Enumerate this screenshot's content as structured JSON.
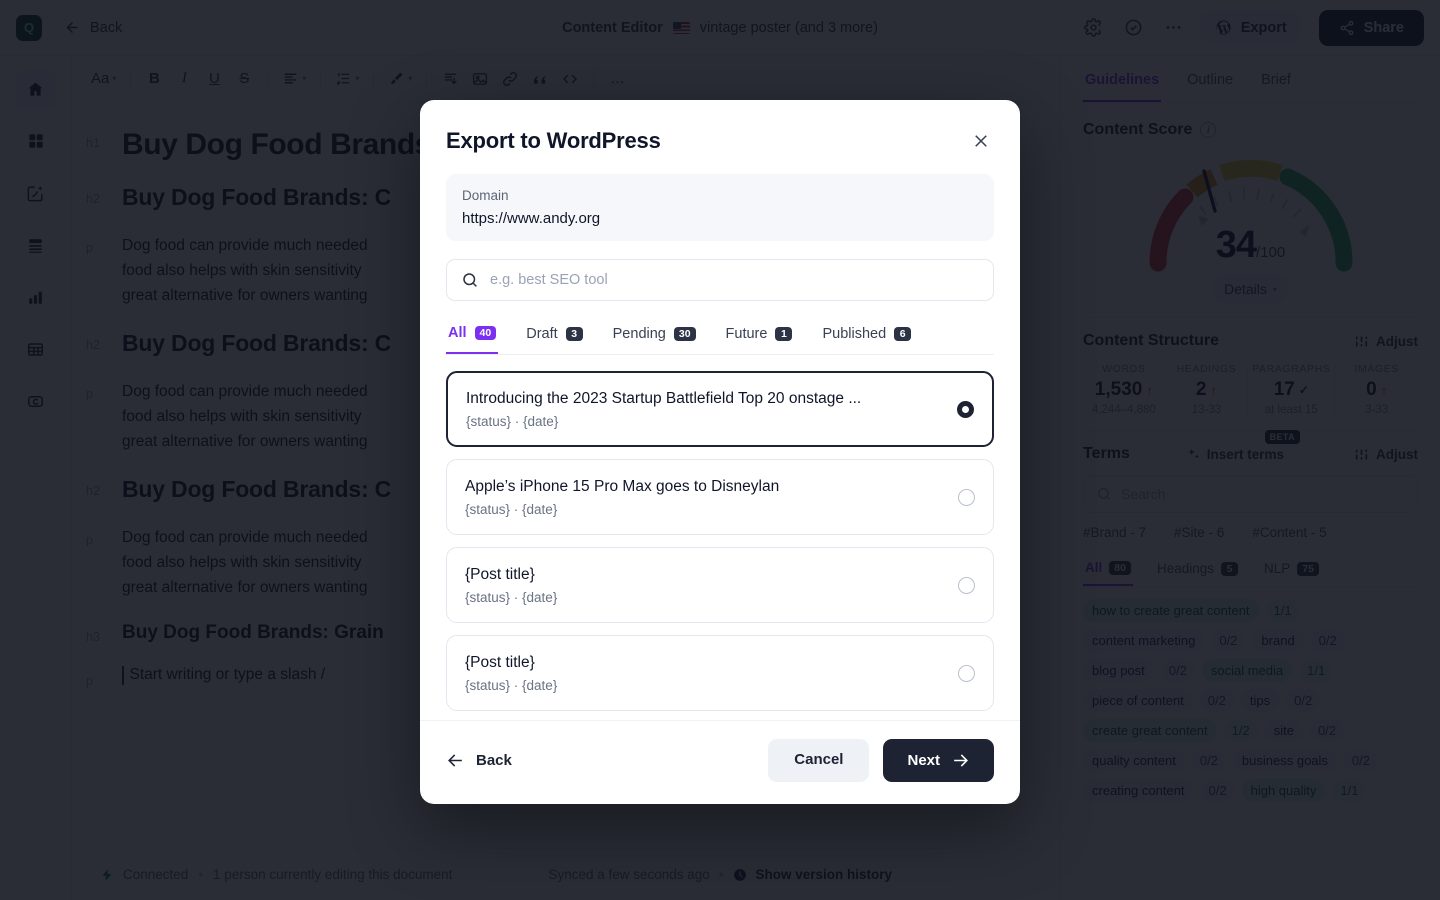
{
  "app": {
    "logo_text": "Q",
    "back_label": "Back",
    "header_title": "Content Editor",
    "document_name": "vintage poster (and 3 more)",
    "export_label": "Export",
    "share_label": "Share"
  },
  "rail": [
    {
      "name": "home-icon"
    },
    {
      "name": "grid-icon"
    },
    {
      "name": "magic-edit-icon"
    },
    {
      "name": "list-icon"
    },
    {
      "name": "bar-chart-icon"
    },
    {
      "name": "table-icon"
    },
    {
      "name": "badge-icon"
    }
  ],
  "toolbar": {
    "font_label": "Aa",
    "bold": "B",
    "italic": "I",
    "underline": "U",
    "strike": "S",
    "more": "…"
  },
  "document": {
    "blocks": [
      {
        "tag": "h1",
        "text": "Buy Dog Food Brands",
        "style": "h1t"
      },
      {
        "tag": "h2",
        "text": "Buy Dog Food Brands: C",
        "style": "h2t"
      },
      {
        "tag": "p",
        "text": "Dog food can provide much needed\nfood also helps with skin sensitivity\ngreat alternative for owners wanting",
        "style": "pt"
      },
      {
        "tag": "h2",
        "text": "Buy Dog Food Brands: C",
        "style": "h2t"
      },
      {
        "tag": "p",
        "text": "Dog food can provide much needed\nfood also helps with skin sensitivity\ngreat alternative for owners wanting",
        "style": "pt"
      },
      {
        "tag": "h2",
        "text": "Buy Dog Food Brands: C",
        "style": "h2t"
      },
      {
        "tag": "p",
        "text": "Dog food can provide much needed\nfood also helps with skin sensitivity\ngreat alternative for owners wanting",
        "style": "pt"
      },
      {
        "tag": "h3",
        "text": "Buy Dog Food Brands: Grain",
        "style": "h3t"
      }
    ],
    "editor_placeholder": "Start writing or type a slash /"
  },
  "status": {
    "connection": "Connected",
    "sep": "•",
    "editors": "1 person currently editing this document",
    "synced": "Synced a few seconds ago",
    "version_history": "Show version history"
  },
  "right_panel": {
    "tabs": [
      {
        "label": "Guidelines",
        "active": true
      },
      {
        "label": "Outline",
        "active": false
      },
      {
        "label": "Brief",
        "active": false
      }
    ],
    "content_score": {
      "title": "Content Score",
      "value": "34",
      "max": "/100",
      "details_label": "Details"
    },
    "content_structure": {
      "title": "Content Structure",
      "adjust_label": "Adjust",
      "stats": [
        {
          "label": "WORDS",
          "value": "1,530",
          "indicator": "up",
          "range": "4,244–4,880"
        },
        {
          "label": "HEADINGS",
          "value": "2",
          "indicator": "up",
          "range": "13-33"
        },
        {
          "label": "PARAGRAPHS",
          "value": "17",
          "indicator": "ok",
          "range": "at least 15"
        },
        {
          "label": "IMAGES",
          "value": "0",
          "indicator": "up",
          "range": "3-33"
        }
      ]
    },
    "terms": {
      "title": "Terms",
      "insert_label": "Insert terms",
      "beta_label": "BETA",
      "adjust_label": "Adjust",
      "search_placeholder": "Search",
      "hash_filters": [
        "#Brand - 7",
        "#Site - 6",
        "#Content - 5"
      ],
      "tabs": [
        {
          "label": "All",
          "count": "80",
          "active": true
        },
        {
          "label": "Headings",
          "count": "5",
          "active": false
        },
        {
          "label": "NLP",
          "count": "75",
          "active": false
        }
      ],
      "chips": [
        {
          "name": "how to create great content",
          "count": "1/1",
          "done": true
        },
        {
          "name": "content marketing",
          "count": "0/2",
          "done": false
        },
        {
          "name": "brand",
          "count": "0/2",
          "done": false
        },
        {
          "name": "blog post",
          "count": "0/2",
          "done": false
        },
        {
          "name": "social media",
          "count": "1/1",
          "done": true
        },
        {
          "name": "piece of content",
          "count": "0/2",
          "done": false
        },
        {
          "name": "tips",
          "count": "0/2",
          "done": false
        },
        {
          "name": "create great content",
          "count": "1/2",
          "done": true
        },
        {
          "name": "site",
          "count": "0/2",
          "done": false
        },
        {
          "name": "quality content",
          "count": "0/2",
          "done": false
        },
        {
          "name": "business goals",
          "count": "0/2",
          "done": false
        },
        {
          "name": "creating content",
          "count": "0/2",
          "done": false
        },
        {
          "name": "high quality",
          "count": "1/1",
          "done": true
        }
      ]
    }
  },
  "modal": {
    "title": "Export to WordPress",
    "domain_label": "Domain",
    "domain_value": "https://www.andy.org",
    "search_placeholder": "e.g. best SEO tool",
    "search_value": "",
    "tabs": [
      {
        "label": "All",
        "count": "40",
        "active": true
      },
      {
        "label": "Draft",
        "count": "3",
        "active": false
      },
      {
        "label": "Pending",
        "count": "30",
        "active": false
      },
      {
        "label": "Future",
        "count": "1",
        "active": false
      },
      {
        "label": "Published",
        "count": "6",
        "active": false
      }
    ],
    "posts": [
      {
        "title": "Introducing the 2023 Startup Battlefield Top 20 onstage ...",
        "meta": "{status} · {date}",
        "selected": true
      },
      {
        "title": "Apple’s iPhone 15 Pro Max goes to Disneylan",
        "meta": "{status} · {date}",
        "selected": false
      },
      {
        "title": "{Post title}",
        "meta": "{status} · {date}",
        "selected": false
      },
      {
        "title": "{Post title}",
        "meta": "{status} · {date}",
        "selected": false
      }
    ],
    "back_label": "Back",
    "cancel_label": "Cancel",
    "next_label": "Next"
  },
  "colors": {
    "accent_purple": "#7b2ff0",
    "dark": "#1d2333",
    "danger": "#e03b3b",
    "success": "#2c6b45"
  }
}
